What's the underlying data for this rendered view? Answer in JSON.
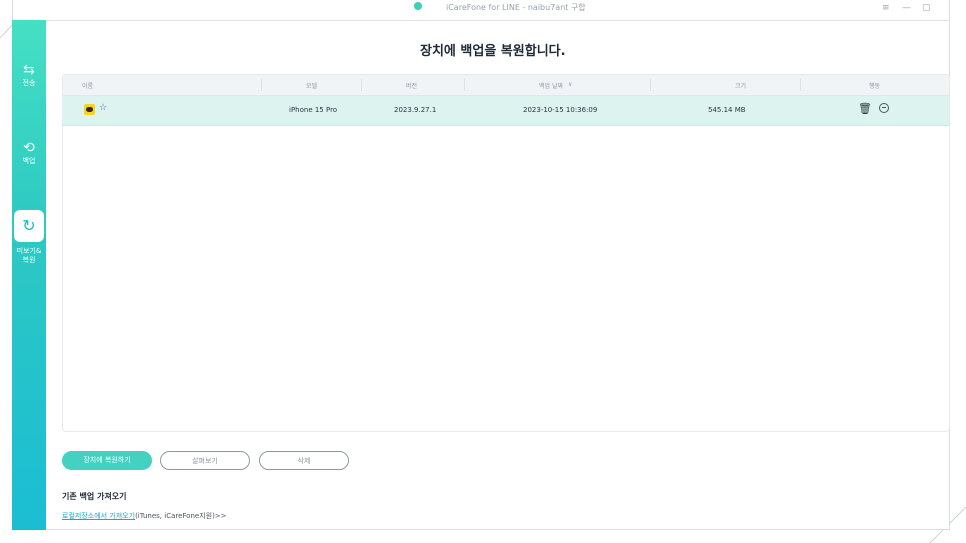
{
  "window": {
    "title": "iCareFone for LINE - naibu7ant 구합"
  },
  "sidebar": {
    "items": [
      {
        "label": "전송",
        "icon": "transfer-icon"
      },
      {
        "label": "백업",
        "icon": "sync-icon"
      },
      {
        "label": "미리보기&복원",
        "label_line1": "미보기&",
        "label_line2": "복원",
        "icon": "restore-icon",
        "active": true
      }
    ]
  },
  "main": {
    "heading": "장치에 백업을 복원합니다."
  },
  "table": {
    "columns": [
      "이름",
      "모델",
      "버전",
      "백업 날짜",
      "크기",
      "행동"
    ],
    "rows": [
      {
        "name": "☆",
        "model": "iPhone 15 Pro",
        "version": "2023.9.27.1",
        "date": "2023-10-15 10:36:09",
        "size": "545.14 MB"
      }
    ]
  },
  "buttons": {
    "restore": "장치에 복원하기",
    "preview": "살펴보기",
    "delete": "삭제"
  },
  "legacy": {
    "title": "기존 백업 가져오기",
    "link": "로컬저장소에서 가져오기",
    "suffix": "(iTunes, iCareFone지원)>>"
  },
  "colors": {
    "accent": "#43d1c2",
    "selected_row": "#ddf3ef",
    "sidebar_top": "#45e0c3",
    "sidebar_bottom": "#1bbdd3"
  }
}
